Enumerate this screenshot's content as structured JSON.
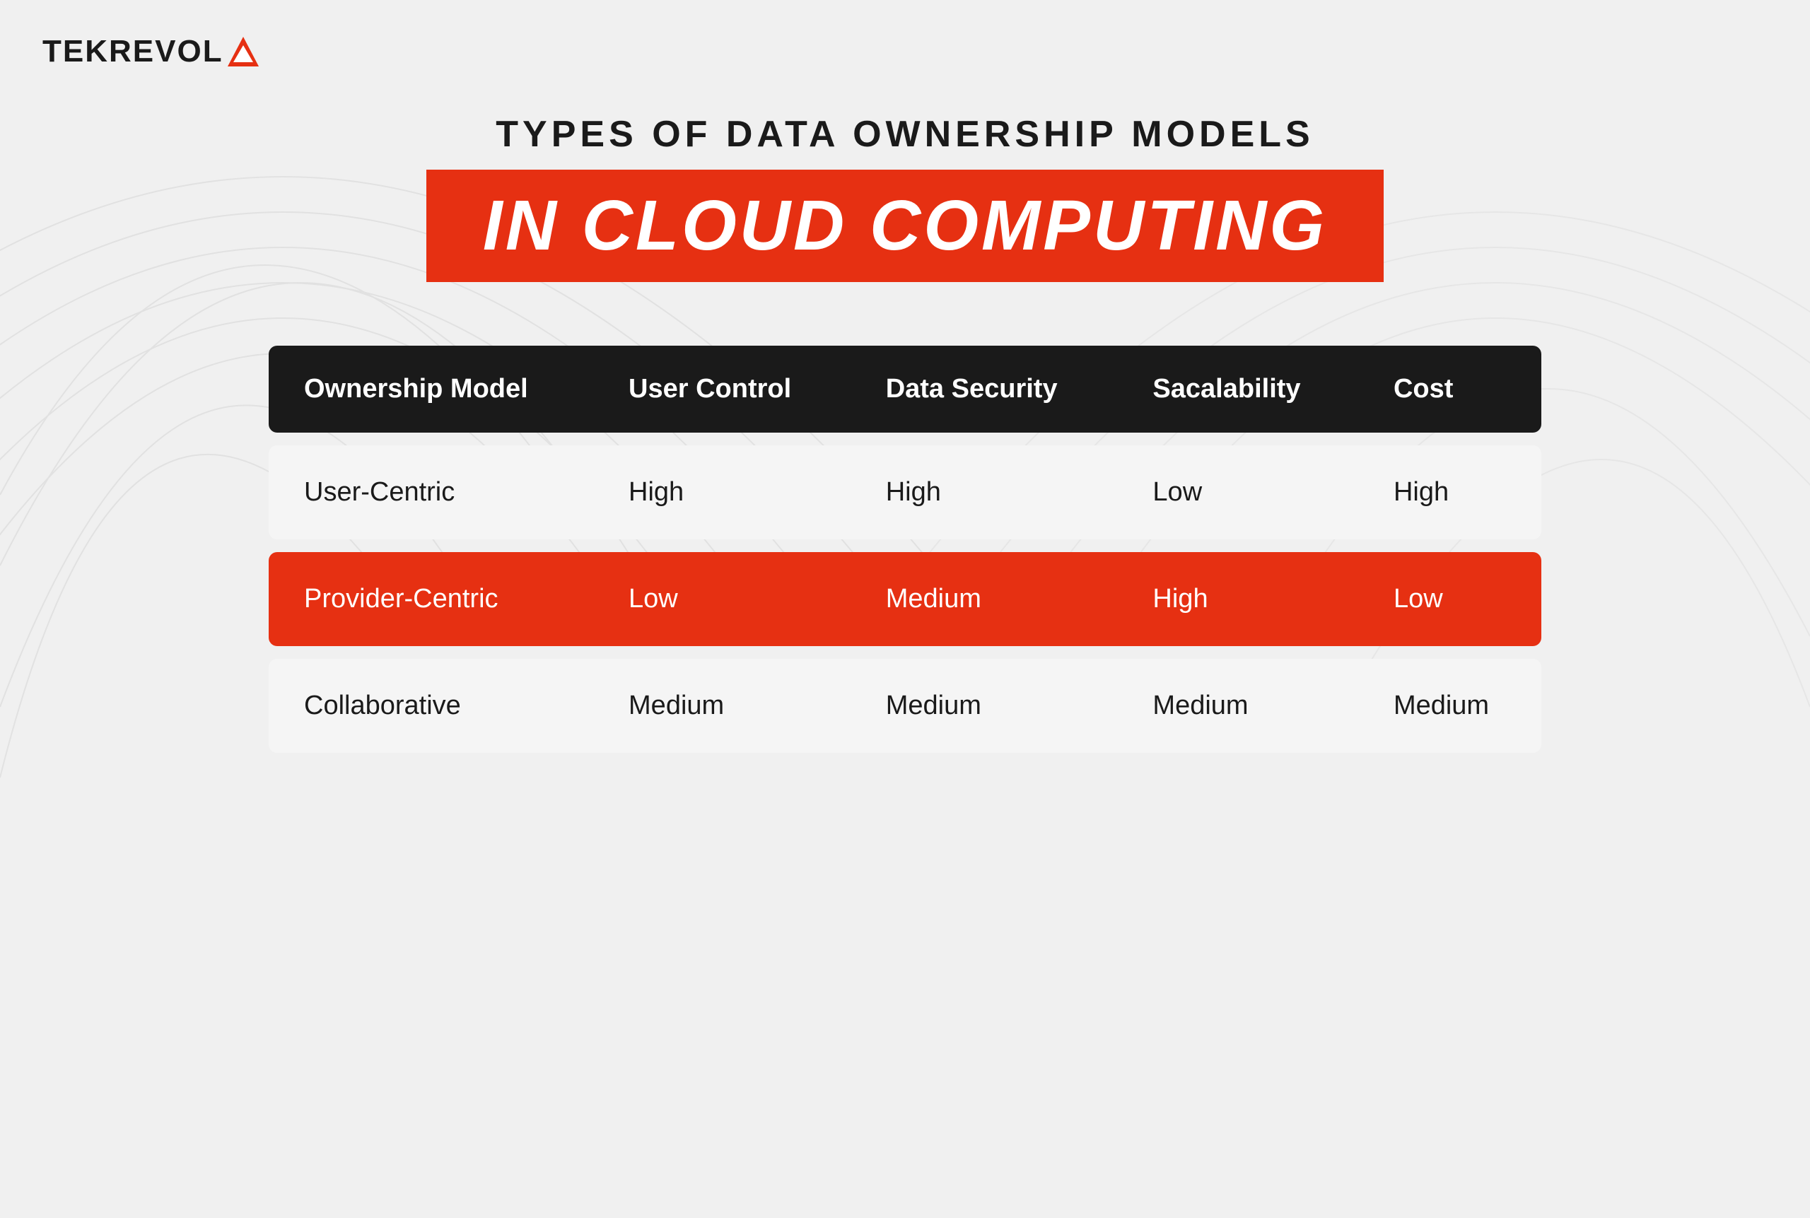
{
  "logo": {
    "text": "TEKREVOL",
    "icon": "▲"
  },
  "title": {
    "subtitle": "TYPES OF DATA OWNERSHIP MODELS",
    "main": "IN CLOUD COMPUTING"
  },
  "table": {
    "headers": [
      "Ownership Model",
      "User Control",
      "Data Security",
      "Sacalability",
      "Cost"
    ],
    "rows": [
      {
        "model": "User-Centric",
        "user_control": "High",
        "data_security": "High",
        "scalability": "Low",
        "cost": "High",
        "highlight": false
      },
      {
        "model": "Provider-Centric",
        "user_control": "Low",
        "data_security": "Medium",
        "scalability": "High",
        "cost": "Low",
        "highlight": true
      },
      {
        "model": "Collaborative",
        "user_control": "Medium",
        "data_security": "Medium",
        "scalability": "Medium",
        "cost": "Medium",
        "highlight": false
      }
    ]
  },
  "colors": {
    "accent": "#e63012",
    "dark": "#1a1a1a",
    "light_bg": "#f5f5f5",
    "white": "#ffffff"
  }
}
